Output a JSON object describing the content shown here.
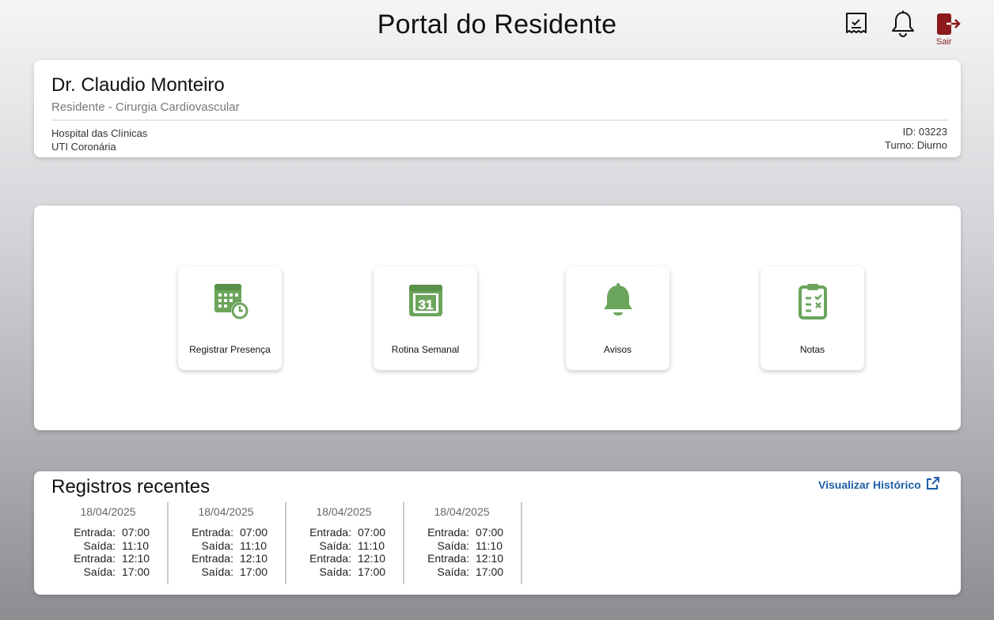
{
  "header": {
    "title": "Portal do Residente",
    "icons": [
      "checklist-icon",
      "bell-icon",
      "logout-icon"
    ],
    "exit_label": "Sair"
  },
  "profile": {
    "name": "Dr. Claudio Monteiro",
    "role": "Residente - Cirurgia Cardiovascular",
    "hospital": "Hospital das Clínicas",
    "unit": "UTI Coronária",
    "id": "ID: 03223",
    "shift": "Turno: Diurno"
  },
  "actions": [
    {
      "label": "Registrar Presença",
      "icon": "calendar-clock-icon"
    },
    {
      "label": "Rotina Semanal",
      "icon": "calendar-31-icon"
    },
    {
      "label": "Avisos",
      "icon": "bell-icon"
    },
    {
      "label": "Notas",
      "icon": "clipboard-icon"
    }
  ],
  "records": {
    "title": "Registros recentes",
    "history_link": "Visualizar Histórico",
    "entries": [
      {
        "date": "18/04/2025",
        "rows": [
          {
            "label": "Entrada:",
            "time": "07:00"
          },
          {
            "label": "Saída:",
            "time": "11:10"
          },
          {
            "label": "Entrada:",
            "time": "12:10"
          },
          {
            "label": "Saída:",
            "time": "17:00"
          }
        ]
      },
      {
        "date": "18/04/2025",
        "rows": [
          {
            "label": "Entrada:",
            "time": "07:00"
          },
          {
            "label": "Saída:",
            "time": "11:10"
          },
          {
            "label": "Entrada:",
            "time": "12:10"
          },
          {
            "label": "Saída:",
            "time": "17:00"
          }
        ]
      },
      {
        "date": "18/04/2025",
        "rows": [
          {
            "label": "Entrada:",
            "time": "07:00"
          },
          {
            "label": "Saída:",
            "time": "11:10"
          },
          {
            "label": "Entrada:",
            "time": "12:10"
          },
          {
            "label": "Saída:",
            "time": "17:00"
          }
        ]
      },
      {
        "date": "18/04/2025",
        "rows": [
          {
            "label": "Entrada:",
            "time": "07:00"
          },
          {
            "label": "Saída:",
            "time": "11:10"
          },
          {
            "label": "Entrada:",
            "time": "12:10"
          },
          {
            "label": "Saída:",
            "time": "17:00"
          }
        ]
      }
    ]
  },
  "colors": {
    "accent_green": "#6ba55b",
    "link_blue": "#1f5fa8",
    "exit_red": "#8b1a1a"
  }
}
